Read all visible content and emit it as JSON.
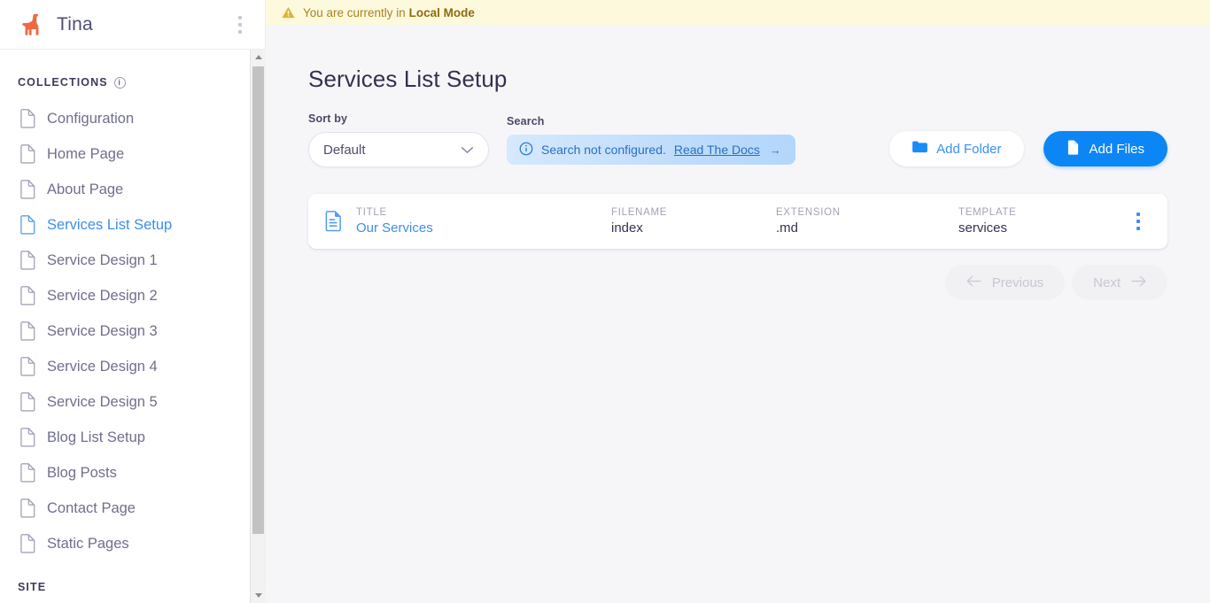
{
  "sidebar": {
    "brand": "Tina",
    "logo_icon": "llama-logo",
    "menu_icon": "kebab-menu-icon",
    "collections_label": "COLLECTIONS",
    "collections_info_icon": "info-icon",
    "site_label": "SITE",
    "items": [
      {
        "label": "Configuration",
        "icon": "document-icon",
        "active": false
      },
      {
        "label": "Home Page",
        "icon": "document-icon",
        "active": false
      },
      {
        "label": "About Page",
        "icon": "document-icon",
        "active": false
      },
      {
        "label": "Services List Setup",
        "icon": "document-icon",
        "active": true
      },
      {
        "label": "Service Design 1",
        "icon": "document-icon",
        "active": false
      },
      {
        "label": "Service Design 2",
        "icon": "document-icon",
        "active": false
      },
      {
        "label": "Service Design 3",
        "icon": "document-icon",
        "active": false
      },
      {
        "label": "Service Design 4",
        "icon": "document-icon",
        "active": false
      },
      {
        "label": "Service Design 5",
        "icon": "document-icon",
        "active": false
      },
      {
        "label": "Blog List Setup",
        "icon": "document-icon",
        "active": false
      },
      {
        "label": "Blog Posts",
        "icon": "document-icon",
        "active": false
      },
      {
        "label": "Contact Page",
        "icon": "document-icon",
        "active": false
      },
      {
        "label": "Static Pages",
        "icon": "document-icon",
        "active": false
      }
    ]
  },
  "banner": {
    "icon": "warning-triangle-icon",
    "text_prefix": "You are currently in ",
    "mode": "Local Mode"
  },
  "page": {
    "title": "Services List Setup"
  },
  "toolbar": {
    "sort_label": "Sort by",
    "sort_value": "Default",
    "sort_chevron_icon": "chevron-down-icon",
    "search_label": "Search",
    "search_notice_icon": "info-circle-icon",
    "search_notice_text": "Search not configured.",
    "search_docs_link": "Read The Docs",
    "search_docs_arrow": "→",
    "add_folder_label": "Add Folder",
    "add_folder_icon": "folder-icon",
    "add_files_label": "Add Files",
    "add_files_icon": "file-icon"
  },
  "table": {
    "columns": {
      "title": "TITLE",
      "filename": "FILENAME",
      "extension": "EXTENSION",
      "template": "TEMPLATE"
    },
    "rows": [
      {
        "icon": "file-text-icon",
        "title": "Our Services",
        "filename": "index",
        "extension": ".md",
        "template": "services",
        "menu_icon": "kebab-menu-icon"
      }
    ]
  },
  "pagination": {
    "previous_label": "Previous",
    "previous_icon": "arrow-left-icon",
    "next_label": "Next",
    "next_icon": "arrow-right-icon"
  },
  "colors": {
    "accent_blue": "#3b8ff0",
    "primary_button": "#0d86f5",
    "brand_orange": "#ed6a43",
    "banner_bg": "#fdf9dd",
    "banner_text": "#a9831f",
    "app_bg": "#f6f6f9"
  }
}
